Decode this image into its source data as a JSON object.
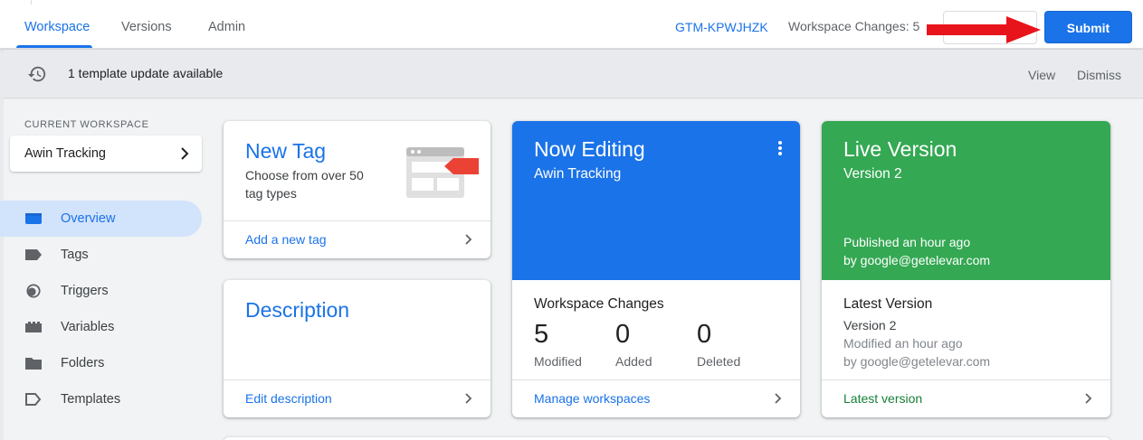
{
  "nav": {
    "tabs": [
      {
        "label": "Workspace"
      },
      {
        "label": "Versions"
      },
      {
        "label": "Admin"
      }
    ],
    "container_id": "GTM-KPWJHZK",
    "workspace_changes": "Workspace Changes: 5",
    "submit_label": "Submit"
  },
  "notice": {
    "text": "1 template update available",
    "view_label": "View",
    "dismiss_label": "Dismiss"
  },
  "sidebar": {
    "caption": "CURRENT WORKSPACE",
    "workspace_name": "Awin Tracking",
    "items": [
      {
        "label": "Overview",
        "icon": "overview-icon"
      },
      {
        "label": "Tags",
        "icon": "tag-icon"
      },
      {
        "label": "Triggers",
        "icon": "trigger-icon"
      },
      {
        "label": "Variables",
        "icon": "variable-icon"
      },
      {
        "label": "Folders",
        "icon": "folder-icon"
      },
      {
        "label": "Templates",
        "icon": "template-icon"
      }
    ]
  },
  "cards": {
    "new_tag": {
      "title": "New Tag",
      "description": "Choose from over 50 tag types",
      "footer": "Add a new tag"
    },
    "description": {
      "title": "Description",
      "footer": "Edit description"
    },
    "now_editing": {
      "title": "Now Editing",
      "subtitle": "Awin Tracking",
      "section_title": "Workspace Changes",
      "stats": [
        {
          "value": "5",
          "label": "Modified"
        },
        {
          "value": "0",
          "label": "Added"
        },
        {
          "value": "0",
          "label": "Deleted"
        }
      ],
      "footer": "Manage workspaces"
    },
    "live_version": {
      "title": "Live Version",
      "subtitle": "Version 2",
      "published": "Published an hour ago",
      "published_by": "by google@getelevar.com",
      "section_title": "Latest Version",
      "version": "Version 2",
      "modified": "Modified an hour ago",
      "modified_by": "by google@getelevar.com",
      "footer": "Latest version"
    }
  },
  "colors": {
    "accent_blue": "#1a73e8",
    "live_green": "#34a853",
    "annotation_red": "#e8141b"
  }
}
